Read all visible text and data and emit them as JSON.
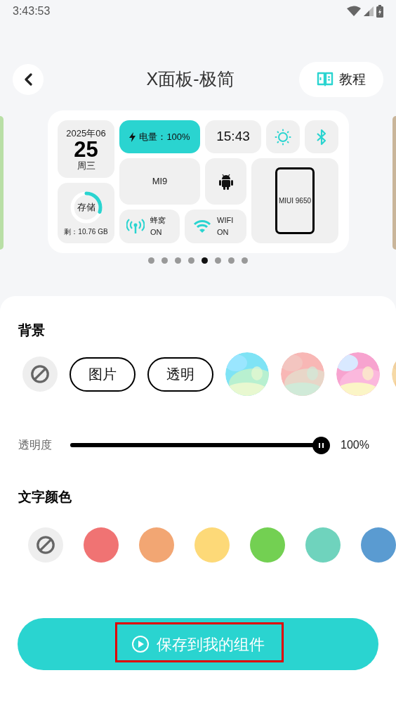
{
  "status_bar": {
    "time": "3:43:53"
  },
  "header": {
    "title": "X面板-极简",
    "tutorial_button": "教程"
  },
  "preview": {
    "date": {
      "year_month": "2025年06",
      "day": "25",
      "weekday": "周三"
    },
    "battery": {
      "label": "电量：100%"
    },
    "clock": "15:43",
    "storage": {
      "label": "存储",
      "remaining": "剩：10.76 GB"
    },
    "device": "MI9",
    "cellular": {
      "label": "蜂窝",
      "state": "ON"
    },
    "wifi": {
      "label": "WIFI",
      "state": "ON"
    },
    "phone": "MIUI 9650"
  },
  "pager": [
    {
      "selected": false
    },
    {
      "selected": false
    },
    {
      "selected": false
    },
    {
      "selected": false
    },
    {
      "selected": true
    },
    {
      "selected": false
    },
    {
      "selected": false
    },
    {
      "selected": false
    }
  ],
  "background": {
    "title": "背景",
    "options": [
      {
        "kind": "none"
      },
      {
        "kind": "text",
        "label": "图片"
      },
      {
        "kind": "text",
        "label": "透明"
      },
      {
        "kind": "picture"
      },
      {
        "kind": "picture"
      },
      {
        "kind": "picture"
      },
      {
        "kind": "picture"
      }
    ]
  },
  "opacity": {
    "label": "透明度",
    "level": 1.0,
    "reading": "100%"
  },
  "text_color": {
    "title": "文字颜色",
    "swatches": [
      {
        "kind": "none"
      },
      {
        "kind": "color",
        "color": "#f07373"
      },
      {
        "kind": "color",
        "color": "#f2a673"
      },
      {
        "kind": "color",
        "color": "#fdd978"
      },
      {
        "kind": "color",
        "color": "#73d052"
      },
      {
        "kind": "color",
        "color": "#6fd3bd"
      },
      {
        "kind": "color",
        "color": "#5a9bd1"
      }
    ]
  },
  "save_button": {
    "label": "保存到我的组件",
    "highlighted": true
  }
}
